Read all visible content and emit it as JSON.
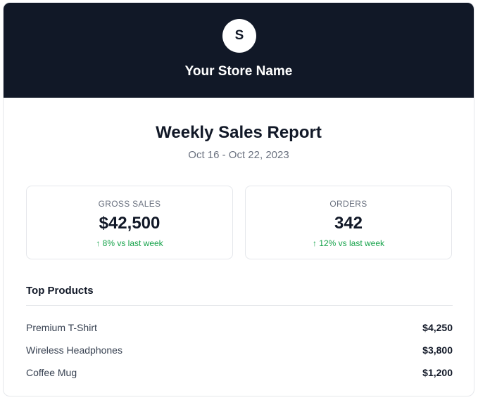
{
  "header": {
    "logo_letter": "S",
    "store_name": "Your Store Name"
  },
  "report": {
    "title": "Weekly Sales Report",
    "date_range": "Oct 16 - Oct 22, 2023"
  },
  "stats": [
    {
      "label": "GROSS SALES",
      "value": "$42,500",
      "change": "↑ 8% vs last week"
    },
    {
      "label": "ORDERS",
      "value": "342",
      "change": "↑ 12% vs last week"
    }
  ],
  "top_products": {
    "title": "Top Products",
    "items": [
      {
        "name": "Premium T-Shirt",
        "amount": "$4,250"
      },
      {
        "name": "Wireless Headphones",
        "amount": "$3,800"
      },
      {
        "name": "Coffee Mug",
        "amount": "$1,200"
      }
    ]
  },
  "colors": {
    "header_bg": "#111827",
    "positive": "#16a34a",
    "muted": "#6b7280"
  }
}
